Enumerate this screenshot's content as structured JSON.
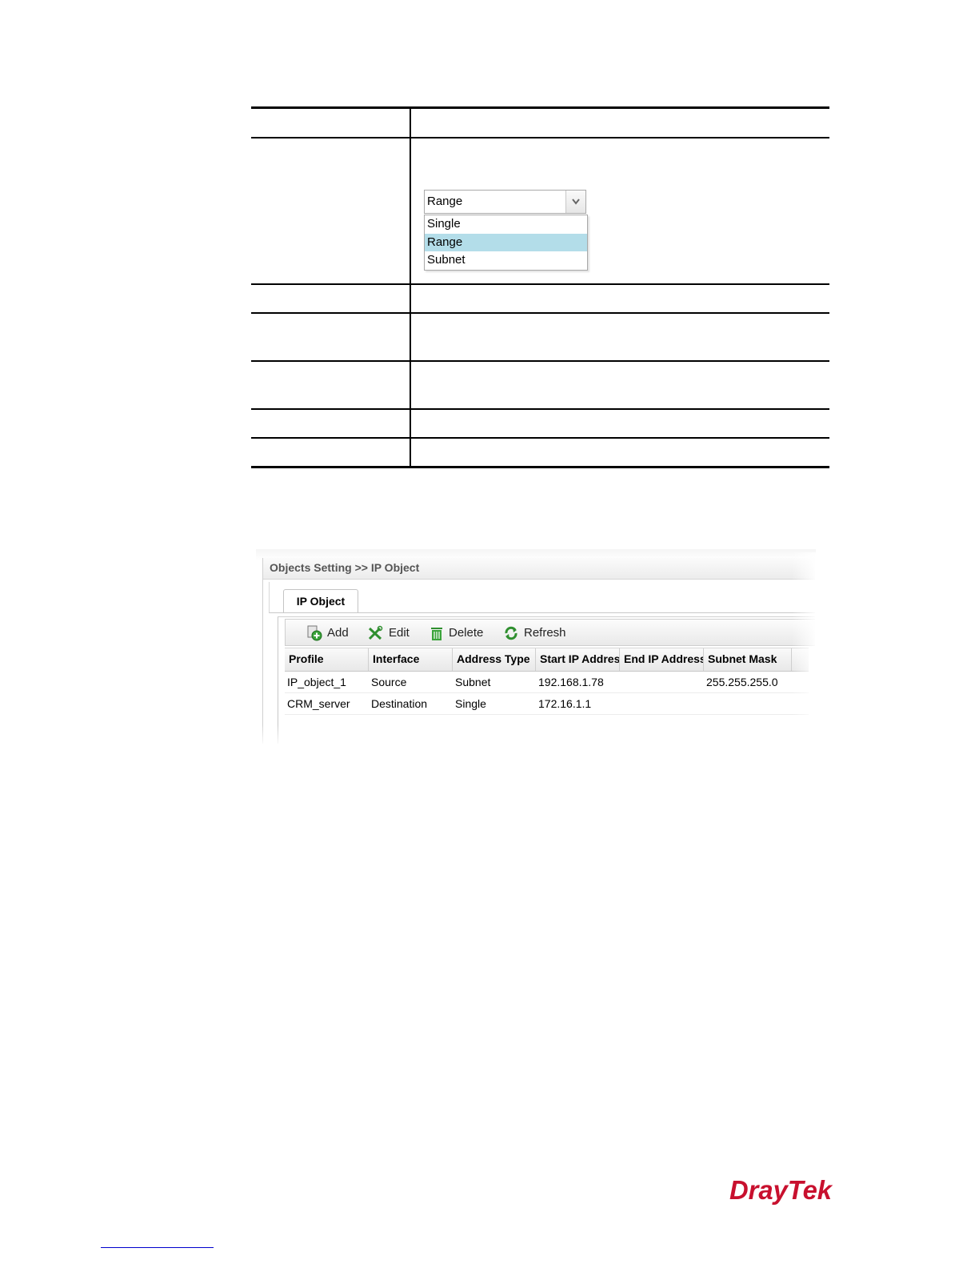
{
  "dropdown": {
    "selected": "Range",
    "options": [
      {
        "label": "Single",
        "selected": false
      },
      {
        "label": "Range",
        "selected": true
      },
      {
        "label": "Subnet",
        "selected": false
      }
    ]
  },
  "panel": {
    "breadcrumb": "Objects Setting >> IP Object",
    "tab": "IP Object",
    "toolbar": {
      "add": "Add",
      "edit": "Edit",
      "delete": "Delete",
      "refresh": "Refresh"
    },
    "columns": [
      "Profile",
      "Interface",
      "Address Type",
      "Start IP Address",
      "End IP Address",
      "Subnet Mask"
    ],
    "rows": [
      [
        "IP_object_1",
        "Source",
        "Subnet",
        "192.168.1.78",
        "",
        "255.255.255.0"
      ],
      [
        "CRM_server",
        "Destination",
        "Single",
        "172.16.1.1",
        "",
        ""
      ]
    ]
  },
  "logo": {
    "text": "DrayTek",
    "color": "#c8102e"
  }
}
